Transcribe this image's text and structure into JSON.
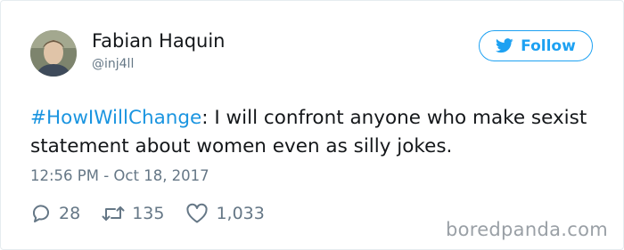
{
  "tweet": {
    "author_name": "Fabian Haquin",
    "author_handle": "@inj4ll",
    "follow_label": "Follow",
    "hashtag": "#HowIWillChange",
    "text_after_hashtag": ": I will confront anyone who make sexist statement about women even as silly jokes.",
    "timestamp": "12:56 PM - Oct 18, 2017",
    "replies": "28",
    "retweets": "135",
    "likes": "1,033"
  },
  "watermark": "boredpanda.com",
  "icons": {
    "follow": "twitter-bird-icon",
    "reply": "reply-icon",
    "retweet": "retweet-icon",
    "like": "heart-icon"
  },
  "colors": {
    "accent": "#1da1f2",
    "hashtag": "#1b95e0",
    "muted": "#657786",
    "text": "#14171a"
  }
}
